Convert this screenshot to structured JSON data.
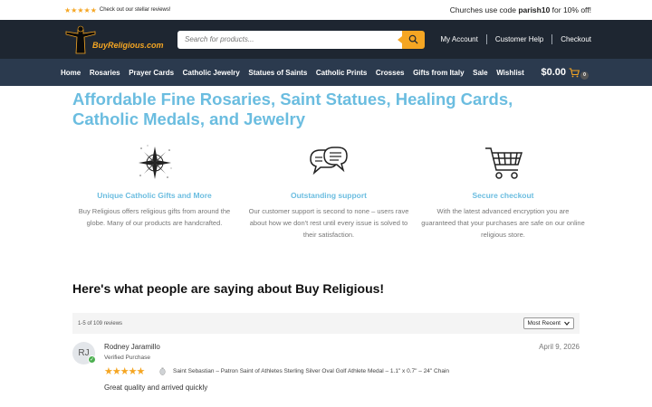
{
  "promo": {
    "stars": "★★★★★",
    "left_text": "Check out our stellar reviews!",
    "right_prefix": "Churches use code ",
    "right_code": "parish10",
    "right_suffix": " for 10% off!"
  },
  "header": {
    "logo_text": "BuyReligious.com",
    "search_placeholder": "Search for products...",
    "links": [
      "My Account",
      "Customer Help",
      "Checkout"
    ]
  },
  "nav": {
    "items": [
      "Home",
      "Rosaries",
      "Prayer Cards",
      "Catholic Jewelry",
      "Statues of Saints",
      "Catholic Prints",
      "Crosses",
      "Gifts from Italy",
      "Sale",
      "Wishlist"
    ],
    "cart_total": "$0.00",
    "cart_count": "0"
  },
  "hero": {
    "title": "Affordable Fine Rosaries, Saint Statues, Healing Cards, Catholic Medals, and Jewelry"
  },
  "features": [
    {
      "icon": "compass-icon",
      "title": "Unique Catholic Gifts and More",
      "text": "Buy Religious offers religious gifts from around the globe. Many of our products are handcrafted."
    },
    {
      "icon": "chat-bubbles-icon",
      "title": "Outstanding support",
      "text": "Our customer support is second to none – users rave about how we don't rest until every issue is solved to their satisfaction."
    },
    {
      "icon": "shopping-cart-icon",
      "title": "Secure checkout",
      "text": "With the latest advanced encryption you are guaranteed that your purchases are safe on our online religious store."
    }
  ],
  "testimonials": {
    "title": "Here's what people are saying about Buy Religious!",
    "count_text": "1-5 of 109 reviews",
    "sort_selected": "Most Recent"
  },
  "review": {
    "initials": "RJ",
    "name": "Rodney Jaramillo",
    "verified": "Verified Purchase",
    "date": "April 9, 2026",
    "stars": "★★★★★",
    "rating": 5,
    "product": "Saint Sebastian – Patron Saint of Athletes Sterling Silver Oval Golf Athlete Medal – 1.1\" x 0.7\" – 24\" Chain",
    "body": "Great quality and arrived quickly"
  },
  "colors": {
    "accent": "#f5a623",
    "header_bg": "#1e2631",
    "nav_bg": "#2b3a4e",
    "heading_blue": "#6bbde0"
  }
}
